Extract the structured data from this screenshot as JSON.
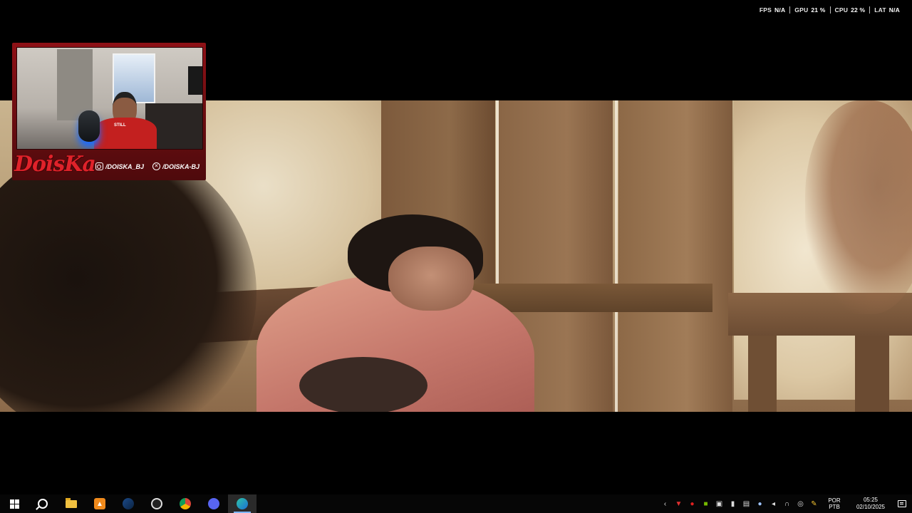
{
  "overlay": {
    "stats": [
      {
        "label": "FPS",
        "value": "N/A"
      },
      {
        "label": "GPU",
        "value": "21 %"
      },
      {
        "label": "CPU",
        "value": "22 %"
      },
      {
        "label": "LAT",
        "value": "N/A"
      }
    ]
  },
  "webcam": {
    "brand": "DoisKa",
    "shirt_text": "STILL",
    "socials": [
      {
        "icon": "instagram-icon",
        "handle": "/DOISKA_BJ"
      },
      {
        "icon": "x-icon",
        "handle": "/DOISKA-BJ"
      }
    ]
  },
  "taskbar": {
    "apps": [
      {
        "name": "start",
        "icon": "windows-icon"
      },
      {
        "name": "search",
        "icon": "search-icon"
      },
      {
        "name": "file-explorer",
        "icon": "folder-icon"
      },
      {
        "name": "app-orange",
        "icon": "orange-app-icon"
      },
      {
        "name": "steam",
        "icon": "steam-icon"
      },
      {
        "name": "obs",
        "icon": "obs-icon"
      },
      {
        "name": "chrome",
        "icon": "chrome-icon"
      },
      {
        "name": "discord",
        "icon": "discord-icon"
      },
      {
        "name": "edge",
        "icon": "edge-icon",
        "active": true
      }
    ],
    "tray": {
      "lang_line1": "POR",
      "lang_line2": "PTB",
      "time": "05:25",
      "date": "02/10/2025"
    }
  },
  "colors": {
    "webcam_frame": "#8e1116",
    "brand_red": "#e0222a",
    "taskbar_bg": "#060606",
    "active_indicator": "#7eb6ff"
  }
}
